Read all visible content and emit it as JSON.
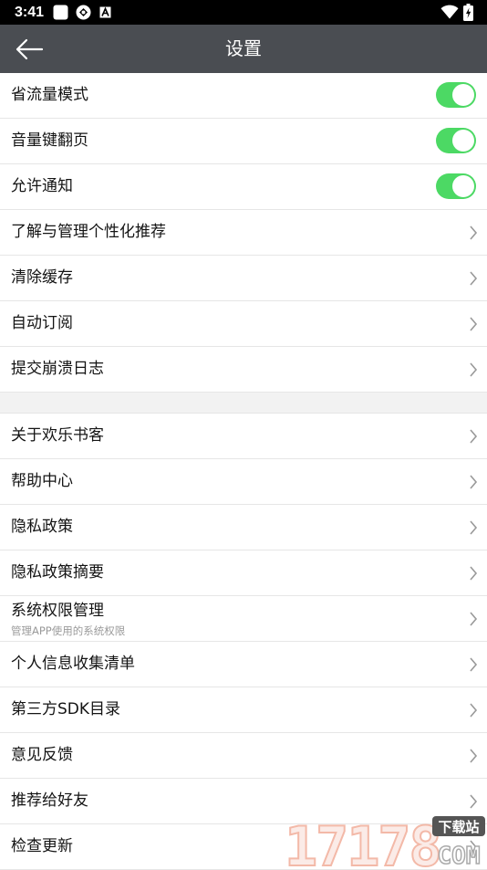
{
  "status_bar": {
    "time": "3:41"
  },
  "toolbar": {
    "title": "设置"
  },
  "settings": {
    "toggles": [
      {
        "label": "省流量模式",
        "on": true
      },
      {
        "label": "音量键翻页",
        "on": true
      },
      {
        "label": "允许通知",
        "on": true
      }
    ],
    "items_a": [
      {
        "label": "了解与管理个性化推荐"
      },
      {
        "label": "清除缓存"
      },
      {
        "label": "自动订阅"
      },
      {
        "label": "提交崩溃日志"
      }
    ],
    "items_b": [
      {
        "label": "关于欢乐书客"
      },
      {
        "label": "帮助中心"
      },
      {
        "label": "隐私政策"
      },
      {
        "label": "隐私政策摘要"
      },
      {
        "label": "系统权限管理",
        "sublabel": "管理APP使用的系统权限"
      },
      {
        "label": "个人信息收集清单"
      },
      {
        "label": "第三方SDK目录"
      },
      {
        "label": "意见反馈"
      },
      {
        "label": "推荐给好友"
      },
      {
        "label": "检查更新"
      }
    ]
  },
  "watermark": {
    "number": "17178",
    "tag": "下载站",
    "domain": "COM"
  },
  "colors": {
    "toolbar": "#4a4d52",
    "toggle_on": "#4cd964",
    "section_gap": "#f2f2f2",
    "divider": "#e6e6e6"
  }
}
